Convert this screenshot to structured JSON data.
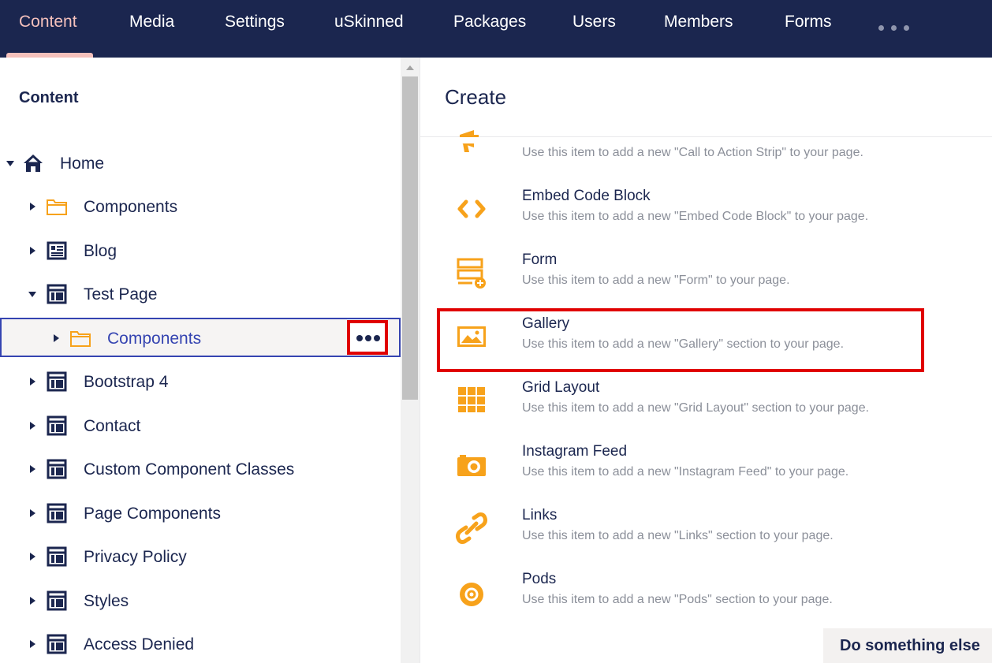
{
  "nav": {
    "items": [
      {
        "label": "Content",
        "active": true
      },
      {
        "label": "Media"
      },
      {
        "label": "Settings"
      },
      {
        "label": "uSkinned"
      },
      {
        "label": "Packages"
      },
      {
        "label": "Users"
      },
      {
        "label": "Members"
      },
      {
        "label": "Forms"
      }
    ],
    "more_icon": "ellipsis-icon"
  },
  "tree": {
    "heading": "Content",
    "nodes": [
      {
        "label": "Home",
        "icon": "home-icon",
        "expanded": true
      },
      {
        "label": "Components",
        "icon": "folder-icon"
      },
      {
        "label": "Blog",
        "icon": "newspaper-icon"
      },
      {
        "label": "Test Page",
        "icon": "page-layout-icon",
        "expanded": true
      },
      {
        "label": "Components",
        "icon": "folder-icon",
        "selected": true
      },
      {
        "label": "Bootstrap 4",
        "icon": "page-layout-icon"
      },
      {
        "label": "Contact",
        "icon": "page-layout-icon"
      },
      {
        "label": "Custom Component Classes",
        "icon": "page-layout-icon"
      },
      {
        "label": "Page Components",
        "icon": "page-layout-icon"
      },
      {
        "label": "Privacy Policy",
        "icon": "page-layout-icon"
      },
      {
        "label": "Styles",
        "icon": "page-layout-icon"
      },
      {
        "label": "Access Denied",
        "icon": "page-layout-icon"
      }
    ]
  },
  "panel": {
    "title": "Create",
    "items": [
      {
        "name": "",
        "desc": "Use this item to add a new \"Call to Action Strip\" to your page.",
        "icon": "megaphone-icon"
      },
      {
        "name": "Embed Code Block",
        "desc": "Use this item to add a new \"Embed Code Block\" to your page.",
        "icon": "code-icon"
      },
      {
        "name": "Form",
        "desc": "Use this item to add a new \"Form\" to your page.",
        "icon": "form-icon"
      },
      {
        "name": "Gallery",
        "desc": "Use this item to add a new \"Gallery\" section to your page.",
        "icon": "image-icon"
      },
      {
        "name": "Grid Layout",
        "desc": "Use this item to add a new \"Grid Layout\" section to your page.",
        "icon": "grid-icon"
      },
      {
        "name": "Instagram Feed",
        "desc": "Use this item to add a new \"Instagram Feed\" to your page.",
        "icon": "camera-icon"
      },
      {
        "name": "Links",
        "desc": "Use this item to add a new \"Links\" section to your page.",
        "icon": "link-icon"
      },
      {
        "name": "Pods",
        "desc": "Use this item to add a new \"Pods\" section to your page.",
        "icon": "target-icon"
      }
    ],
    "footer_button": "Do something else"
  },
  "colors": {
    "nav_bg": "#1b264f",
    "nav_active": "#f5c1bc",
    "accent_orange": "#f7a21b",
    "selected_border": "#3544b1",
    "highlight_red": "#e00000"
  }
}
